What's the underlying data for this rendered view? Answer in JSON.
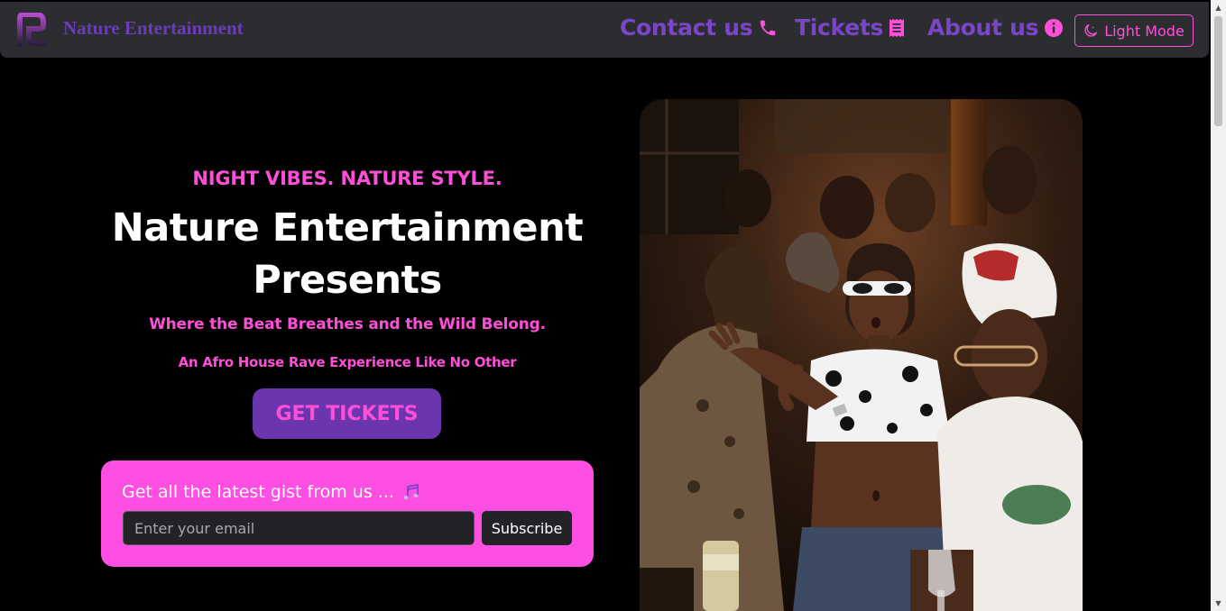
{
  "navbar": {
    "brand": "Nature Entertainment",
    "links": [
      {
        "label": "Contact us",
        "icon": "phone-icon"
      },
      {
        "label": "Tickets",
        "icon": "receipt-icon"
      },
      {
        "label": "About us",
        "icon": "info-circle-icon"
      }
    ],
    "mode_button": "Light Mode"
  },
  "hero": {
    "tagline": "NIGHT VIBES. NATURE STYLE.",
    "title_line1": "Nature Entertainment",
    "title_line2": "Presents",
    "subtitle": "Where the Beat Breathes and the Wild Belong.",
    "sub2": "An Afro House Rave Experience Like No Other",
    "cta_label": "GET TICKETS"
  },
  "newsletter": {
    "heading": "Get all the latest gist from us ...",
    "email_placeholder": "Enter your email",
    "subscribe_label": "Subscribe"
  },
  "colors": {
    "background": "#000000",
    "navbar": "#2b2d31",
    "brand_purple": "#7b45c8",
    "accent_pink": "#ff4fd8",
    "button_purple": "#6a35ad"
  }
}
